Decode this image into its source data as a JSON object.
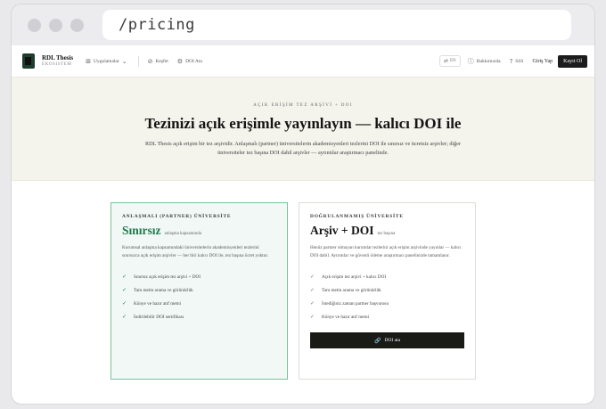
{
  "browser": {
    "url": "/pricing"
  },
  "nav": {
    "brand_name": "RDL Thesis",
    "brand_sub": "EKOSISTEM",
    "apps_label": "Uygulamalar",
    "explore_label": "Keşfet",
    "doi_label": "DOI Ata",
    "lang_label": "EN",
    "about_label": "Hakkımızda",
    "faq_label": "SSS",
    "login_label": "Giriş Yap",
    "signup_label": "Kayıt Ol"
  },
  "hero": {
    "eyebrow": "AÇIK ERİŞİM TEZ ARŞİVİ + DOI",
    "title": "Tezinizi açık erişimle yayınlayın — kalıcı DOI ile",
    "description": "RDL Thesis açık erişim bir tez arşividir. Anlaşmalı (partner) üniversitelerin akademisyenleri tezlerini DOI ile sınırsız ve ücretsiz arşivler; diğer üniversiteler tez başına DOI dahil arşivler — ayrıntılar araştırmacı panelinde."
  },
  "partner_card": {
    "eyebrow": "ANLAŞMALI (PARTNER) ÜNİVERSİTE",
    "price": "Sınırsız",
    "price_note": "anlaşma kapsamında",
    "description": "Kurumsal anlaşma kapsamındaki üniversitelerin akademisyenleri tezlerini sınırsızca açık erişim arşivler — her biri kalıcı DOI ile, tez başına ücret yoktur.",
    "features": [
      "Sınırsız açık erişim tez arşivi + DOI",
      "Tam metin arama ve görünürlük",
      "Künye ve hazır atıf metni",
      "İndirilebilir DOI sertifikası"
    ]
  },
  "plain_card": {
    "eyebrow": "DOĞRULANMAMIŞ ÜNİVERSİTE",
    "price": "Arşiv + DOI",
    "price_note": "tez başına",
    "description": "Henüz partner olmayan kurumlar tezlerini açık erişim arşivinde yayınlar — kalıcı DOI dahil. Ayrıntılar ve güvenli ödeme araştırmacı panelinizde tamamlanır.",
    "features": [
      "Açık erişim tez arşivi + kalıcı DOI",
      "Tam metin arama ve görünürlük",
      "İstediğiniz zaman partner başvurusu",
      "Künye ve hazır atıf metni"
    ],
    "button_label": "DOI ata"
  },
  "colors": {
    "accent_green": "#1f7a4b",
    "dark": "#1a1a17",
    "hero_bg": "#f4f3ec"
  }
}
